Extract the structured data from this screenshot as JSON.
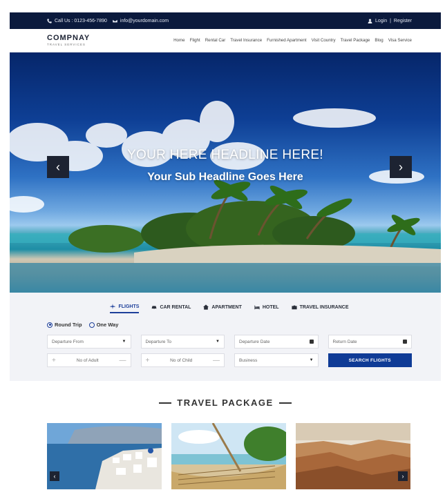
{
  "topbar": {
    "phone": "Call Us : 0123-456-7890",
    "email": "info@yourdomain.com",
    "login": "Login",
    "separator": "|",
    "register": "Register"
  },
  "header": {
    "logo_name": "COMPNAY",
    "logo_tagline": "TRAVEL SERVICES",
    "nav": [
      "Home",
      "Flight",
      "Rental Car",
      "Travel Insurance",
      "Furnished Apartment",
      "Visit Country",
      "Travel Package",
      "Blog",
      "Visa Service"
    ]
  },
  "hero": {
    "headline": "YOUR HERE HEADLINE HERE!",
    "subheadline": "Your Sub Headline Goes Here",
    "prev": "‹",
    "next": "›"
  },
  "search": {
    "tabs": [
      "FLIGHTS",
      "CAR RENTAL",
      "APARTMENT",
      "HOTEL",
      "TRAVEL INSURANCE"
    ],
    "active_tab": "FLIGHTS",
    "trip_types": [
      "Round Trip",
      "One Way"
    ],
    "selected_trip": "Round Trip",
    "departure_from": "Departure From",
    "departure_to": "Departure To",
    "departure_date": "Departure Date",
    "return_date": "Return Date",
    "adults": "No of Adult",
    "children": "No of Child",
    "class_value": "Business",
    "button": "SEARCH FLIGHTS",
    "plus": "+",
    "minus": "—"
  },
  "packages": {
    "title": "TRAVEL PACKAGE",
    "prev": "‹",
    "next": "›"
  },
  "colors": {
    "topbar": "#0b1a3d",
    "accent": "#0f3b96",
    "arrow_bg": "#1d2332"
  }
}
